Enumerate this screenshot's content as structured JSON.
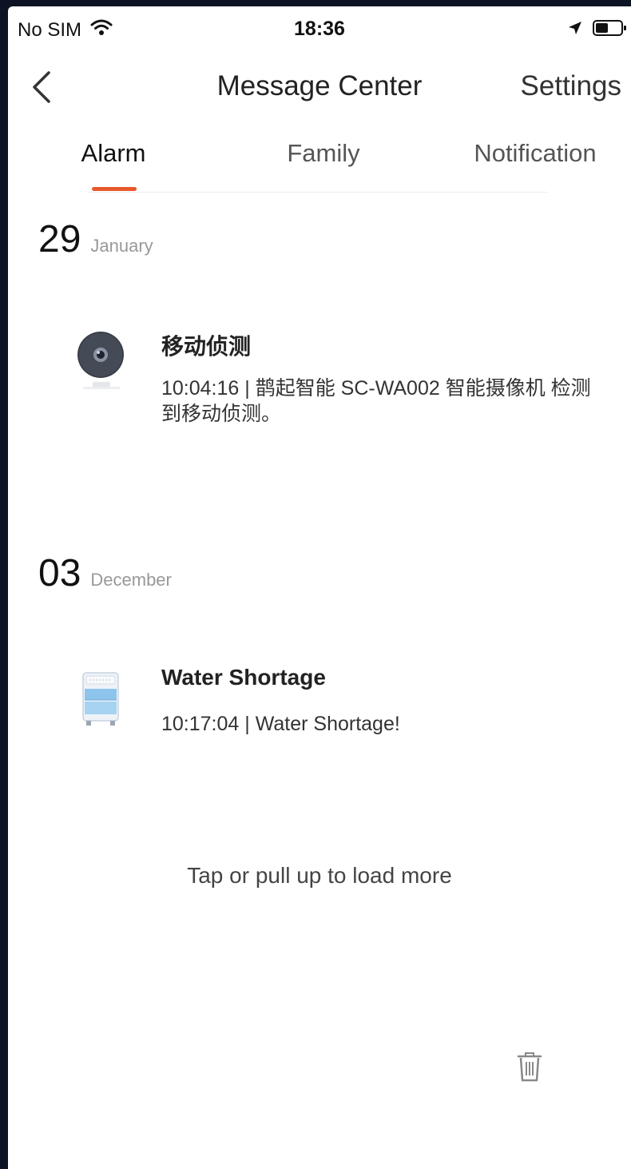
{
  "status_bar": {
    "carrier": "No SIM",
    "time": "18:36",
    "icons": [
      "wifi-icon",
      "location-icon",
      "battery-icon"
    ]
  },
  "nav": {
    "title": "Message Center",
    "settings_label": "Settings",
    "back_icon": "chevron-left-icon"
  },
  "tabs": [
    {
      "label": "Alarm",
      "active": true
    },
    {
      "label": "Family",
      "active": false
    },
    {
      "label": "Notification",
      "active": false
    }
  ],
  "groups": [
    {
      "day": "29",
      "month": "January",
      "messages": [
        {
          "icon": "camera-icon",
          "title": "移动侦测",
          "body": "10:04:16 | 鹊起智能 SC-WA002 智能摄像机 检测到移动侦测。"
        }
      ]
    },
    {
      "day": "03",
      "month": "December",
      "messages": [
        {
          "icon": "water-dispenser-icon",
          "title": "Water Shortage",
          "body": "10:17:04 | Water Shortage!"
        }
      ]
    }
  ],
  "load_more_label": "Tap or pull up to load more",
  "colors": {
    "accent": "#e8592a",
    "background": "#ffffff",
    "frame": "#0c1424"
  }
}
